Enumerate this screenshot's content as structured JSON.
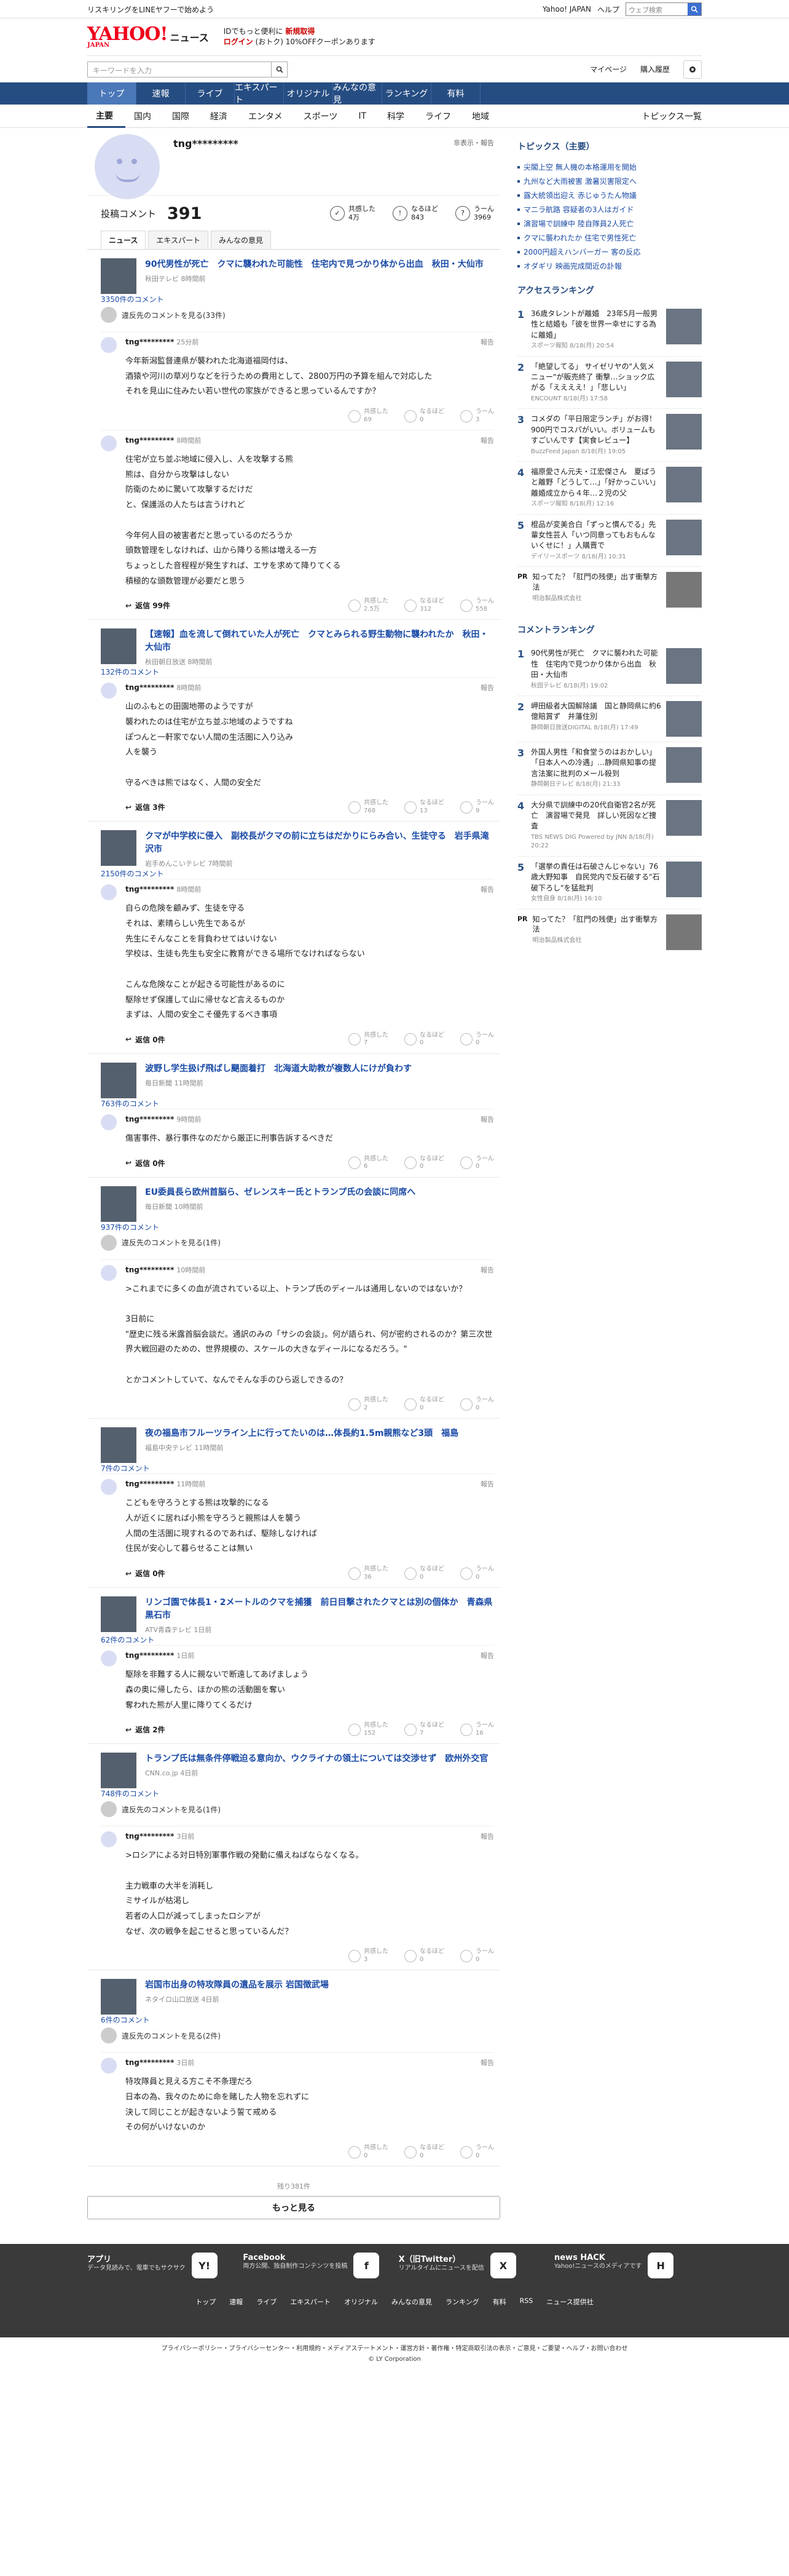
{
  "topbar": {
    "left": "リスキリングをLINEヤフーで始めよう",
    "yjapan": "Yahoo! JAPAN",
    "help": "ヘルプ",
    "search_placeholder": "ウェブ検索",
    "search_btn": "検索"
  },
  "header": {
    "logo": "YAHOO!",
    "logo_sub": "JAPAN",
    "news": "ニュース",
    "promo1": "IDでもっと便利に",
    "promo1b": "新規取得",
    "promo2": "ログイン",
    "promo2b": "(おトク) 10%OFFクーポンあります"
  },
  "search": {
    "placeholder": "キーワードを入力",
    "mypage": "マイページ",
    "history": "購入履歴"
  },
  "gnav": [
    "トップ",
    "速報",
    "ライブ",
    "エキスパート",
    "オリジナル",
    "みんなの意見",
    "ランキング",
    "有料"
  ],
  "cnav": {
    "cats": [
      "主要",
      "国内",
      "国際",
      "経済",
      "エンタメ",
      "スポーツ",
      "IT",
      "科学",
      "ライフ",
      "地域"
    ],
    "list": "トピックス一覧"
  },
  "profile": {
    "name": "tng*********",
    "report": "非表示・報告"
  },
  "stats": {
    "label": "投稿コメント",
    "count": "391",
    "r1a": "共感した",
    "r1b": "4万",
    "r2a": "なるほど",
    "r2b": "843",
    "r3a": "うーん",
    "r3b": "3969"
  },
  "tabs": [
    "ニュース",
    "エキスパート",
    "みんなの意見"
  ],
  "articles": [
    {
      "title": "90代男性が死亡　クマに襲われた可能性　住宅内で見つかり体から出血　秋田・大仙市",
      "src": "秋田テレビ 8時間前",
      "count": "3350件のコメント",
      "block": "違反先のコメントを見る(33件)",
      "comments": [
        {
          "user": "tng*********",
          "time": "25分前",
          "text": "今年新潟監督連県が襲われた北海道福岡付は、\n酒猿や河川の草刈りなどを行うための費用として、2800万円の予算を組んで対応した\nそれを見山に住みたい若い世代の家族ができると思っているんですか？",
          "a": "共感した\n69",
          "b": "なるほど\n0",
          "c": "うーん\n3",
          "reply": ""
        },
        {
          "user": "tng*********",
          "time": "8時間前",
          "text": "住宅が立ち並ぶ地域に侵入し、人を攻撃する熊\n熊は、自分から攻撃はしない\n防衛のために驚いて攻撃するだけだ\nと、保護派の人たちは言うけれど\n\n今年何人目の被害者だと思っているのだろうか\n頭数管理をしなければ、山から降りる熊は増える一方\nちょっとした音程程が発生すれば、エサを求めて降りてくる\n積極的な頭数管理が必要だと思う",
          "a": "共感した\n2.5万",
          "b": "なるほど\n312",
          "c": "うーん\n558",
          "reply": "返信 99件"
        }
      ]
    },
    {
      "title": "【速報】血を流して倒れていた人が死亡　クマとみられる野生動物に襲われたか　秋田・大仙市",
      "src": "秋田朝日放送 8時間前",
      "count": "132件のコメント",
      "block": "",
      "comments": [
        {
          "user": "tng*********",
          "time": "8時間前",
          "text": "山のふもとの田園地帯のようですが\n襲われたのは住宅が立ち並ぶ地域のようですね\nぽつんと一軒家でない人間の生活圏に入り込み\n人を襲う\n\n守るべきは熊ではなく、人間の安全だ",
          "a": "共感した\n768",
          "b": "なるほど\n13",
          "c": "うーん\n9",
          "reply": "返信 3件"
        }
      ]
    },
    {
      "title": "クマが中学校に侵入　副校長がクマの前に立ちはだかりにらみ合い、生徒守る　岩手県滝沢市",
      "src": "岩手めんこいテレビ 7時間前",
      "count": "2150件のコメント",
      "block": "",
      "comments": [
        {
          "user": "tng*********",
          "time": "8時間前",
          "text": "自らの危険を顧みず、生徒を守る\nそれは、素晴らしい先生であるが\n先生にそんなことを背負わせてはいけない\n学校は、生徒も先生も安全に教育ができる場所でなければならない\n\nこんな危険なことが起きる可能性があるのに\n駆除せず保護して山に帰せなど言えるものか\nまずは、人間の安全こそ優先するべき事項",
          "a": "共感した\n7",
          "b": "なるほど\n0",
          "c": "うーん\n0",
          "reply": "返信 0件"
        }
      ]
    },
    {
      "title": "波野し学生扱げ飛ばし颶面着打　北海道大助教が複数人にけが負わす",
      "src": "毎日新聞 11時間前",
      "count": "763件のコメント",
      "block": "",
      "comments": [
        {
          "user": "tng*********",
          "time": "9時間前",
          "text": "傷害事件、暴行事件なのだから厳正に刑事告訴するべきだ",
          "a": "共感した\n6",
          "b": "なるほど\n0",
          "c": "うーん\n0",
          "reply": "返信 0件"
        }
      ]
    },
    {
      "title": "EU委員長ら欧州首脳ら、ゼレンスキー氏とトランプ氏の会談に同席へ",
      "src": "毎日新聞 10時間前",
      "count": "937件のコメント",
      "block": "違反先のコメントを見る(1件)",
      "comments": [
        {
          "user": "tng*********",
          "time": "10時間前",
          "text": ">これまでに多くの血が流されている以上、トランプ氏のディールは通用しないのではないか？\n\n3日前に\n\"歴史に残る米露首脳会談だ。通訳のみの「サシの会談」。何が語られ、何が密約されるのか？第三次世界大戦回避のための、世界規模の、スケールの大きなディールになるだろう。\"\n\nとかコメントしていて、なんでそんな手のひら返しできるの？",
          "a": "共感した\n2",
          "b": "なるほど\n0",
          "c": "うーん\n0",
          "reply": ""
        }
      ]
    },
    {
      "title": "夜の福島市フルーツライン上に行ってたいのは…体長約1.5m親熊など3頭　福島",
      "src": "福島中央テレビ 11時間前",
      "count": "7件のコメント",
      "block": "",
      "comments": [
        {
          "user": "tng*********",
          "time": "11時間前",
          "text": "こどもを守ろうとする熊は攻撃的になる\n人が近くに居れば小熊を守ろうと親熊は人を襲う\n人間の生活圏に現すれるのであれば、駆除しなければ\n住民が安心して暮らせることは無い",
          "a": "共感した\n36",
          "b": "なるほど\n0",
          "c": "うーん\n0",
          "reply": "返信 0件"
        }
      ]
    },
    {
      "title": "リンゴ園で体長1・2メートルのクマを捕獲　前日目撃されたクマとは別の個体か　青森県黒石市",
      "src": "ATV青森テレビ 1日前",
      "count": "62件のコメント",
      "block": "",
      "comments": [
        {
          "user": "tng*********",
          "time": "1日前",
          "text": "駆除を非難する人に親ないで断遠してあげましょう\n森の奥に帰したら、ほかの熊の活動圏を奪い\n奪われた熊が人里に降りてくるだけ",
          "a": "共感した\n152",
          "b": "なるほど\n7",
          "c": "うーん\n16",
          "reply": "返信 2件"
        }
      ]
    },
    {
      "title": "トランプ氏は無条件停戦迫る意向か、ウクライナの領土については交渉せず　欧州外交官",
      "src": "CNN.co.jp 4日前",
      "count": "748件のコメント",
      "block": "違反先のコメントを見る(1件)",
      "comments": [
        {
          "user": "tng*********",
          "time": "3日前",
          "text": ">ロシアによる対日特別軍事作戦の発動に備えねばならなくなる。\n\n主力戦車の大半を消耗し\nミサイルが枯渇し\n若者の人口が減ってしまったロシアが\nなぜ、次の戦争を起こせると思っているんだ？",
          "a": "共感した\n3",
          "b": "なるほど\n0",
          "c": "うーん\n0",
          "reply": ""
        }
      ]
    },
    {
      "title": "岩国市出身の特攻隊員の遺品を展示 岩国徴武場",
      "src": "ネタイロ山口放送 4日前",
      "count": "6件のコメント",
      "block": "違反先のコメントを見る(2件)",
      "comments": [
        {
          "user": "tng*********",
          "time": "3日前",
          "text": "特攻隊員と見える方こそ不条理だろ\n日本の為、我々のために命を賭した人物を忘れずに\n決して同じことが起きないよう誓て戒める\nその何がいけないのか",
          "a": "共感した\n0",
          "b": "なるほど\n0",
          "c": "うーん\n0",
          "reply": ""
        }
      ]
    }
  ],
  "more": {
    "count": "残り381件",
    "button": "もっと見る"
  },
  "side": {
    "topics_head": "トピックス（主要）",
    "topics": [
      "尖閣上空 無人機の本格運用を開始",
      "九州など大雨被害 激暑災害限定へ",
      "露大統領出迎え 赤じゅうたん物議",
      "マニラ航路 容疑者の3人はガイド",
      "演習場で訓練中 陸自隊員2人死亡",
      "クマに襲われたか 住宅で男性死亡",
      "2000円超えハンバーガー 客の反応",
      "オダギリ 映画完成間近の訃報"
    ],
    "access_head": "アクセスランキング",
    "access": [
      {
        "t": "36歳タレントが離婚　23年5月一般男性と結婚も「彼を世界一幸せにする為に離婚」",
        "s": "スポーツ報知 8/18(月) 20:54"
      },
      {
        "t": "「絶望してる」 サイゼリヤの\"人気メニュー\"が販売終了 衝撃…ショック広がる「ええええ！」「悲しい」",
        "s": "ENCOUNT 8/18(月) 17:58"
      },
      {
        "t": "コメダの「平日限定ランチ」がお得！900円でコスパがいい。ボリュームもすごいんです【実食レビュー】",
        "s": "BuzzFeed Japan 8/18(月) 19:05"
      },
      {
        "t": "福原愛さん元夫・江宏傑さん　夏ぱうと離野「どうして…」「好かっこいい」離婚成立から４年…２児の父",
        "s": "スポーツ報知 8/18(月) 12:16"
      },
      {
        "t": "棍品が変美合白「ずっと慣んでる」先輩女性芸人「いつ同意ってもおもんないくせに！」人購賣で",
        "s": "デイリースポーツ 8/18(月) 10:31"
      }
    ],
    "pr1": "知ってた？「肛門の残便」出す衝撃方法",
    "pr1s": "明治製品株式会社",
    "comment_head": "コメントランキング",
    "crank": [
      {
        "t": "90代男性が死亡　クマに襲われた可能性　住宅内で見つかり体から出血　秋田・大仙市",
        "s": "秋田テレビ 8/18(月) 19:02"
      },
      {
        "t": "岬田級者大国解除議　国と静岡県に約6億賠賞ず　井藩住別",
        "s": "静岡朝日放送DIGITAL 8/18(月) 17:49"
      },
      {
        "t": "外国人男性「和食堂うのはおかしい」「日本人への冷遇」…静岡県知事の提言法案に批判のメール殺到",
        "s": "静岡朝日テレビ 8/18(月) 21:33"
      },
      {
        "t": "大分県で訓練中の20代自衛官2名が死亡　演習場で発見　詳しい死因など捜査",
        "s": "TBS NEWS DIG Powered by JNN 8/18(月) 20:22"
      },
      {
        "t": "「選挙の責任は石破さんじゃない」76歳大野知事　自民党内で反石破する\"石破下ろし\"を猛批判",
        "s": "女性自身 8/18(月) 16:10"
      }
    ],
    "pr2": "知ってた？「肛門の残便」出す衝撃方法",
    "pr2s": "明治製品株式会社"
  },
  "footer": {
    "apps": [
      {
        "t": "アプリ",
        "d": "データ見読みで、電車でもサクサク",
        "i": "Y!"
      },
      {
        "t": "Facebook",
        "d": "両方公開、独自制作コンテンツを投稿",
        "i": "f"
      },
      {
        "t": "X（旧Twitter）",
        "d": "リアルタイムにニュースを配信",
        "i": "X"
      },
      {
        "t": "news HACK",
        "d": "Yahoo!ニュースのメディアです",
        "i": "H"
      }
    ],
    "links": [
      "トップ",
      "速報",
      "ライブ",
      "エキスパート",
      "オリジナル",
      "みんなの意見",
      "ランキング",
      "有料",
      "RSS",
      "ニュース提供社"
    ],
    "legal": "プライバシーポリシー・プライバシーセンター・利用規約・メディアステートメント・運営方針・著作権・特定商取引法の表示・ご意見・ご要望・ヘルプ・お問い合わせ",
    "copy": "© LY Corporation"
  }
}
